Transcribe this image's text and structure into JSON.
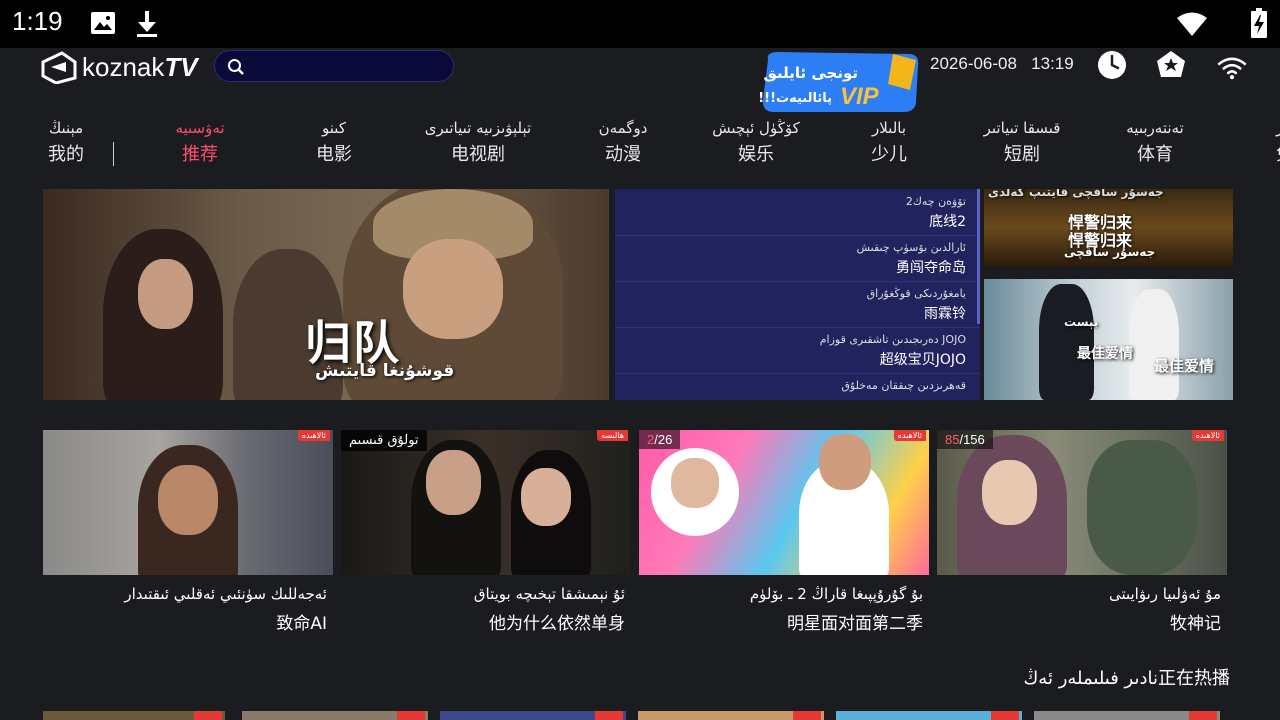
{
  "status_bar": {
    "time": "1:19",
    "icons": [
      "image-icon",
      "download-icon",
      "wifi-icon",
      "battery-icon"
    ]
  },
  "header": {
    "logo_text": "koznak",
    "logo_tv": "TV",
    "search_placeholder": "",
    "vip_banner": {
      "line1": "تونجى ئايلىق",
      "line2": "!!!پائالىيەت",
      "badge": "VIP"
    },
    "date": "2026-06-08",
    "time": "13:19",
    "icons": [
      "clock-icon",
      "home-star-icon",
      "wifi-icon"
    ]
  },
  "nav": {
    "items": [
      {
        "ug": "مېنىڭ",
        "zh": "我的",
        "active": false
      },
      {
        "ug": "تەۋسىيە",
        "zh": "推荐",
        "active": true
      },
      {
        "ug": "كىنو",
        "zh": "电影",
        "active": false
      },
      {
        "ug": "تېلېۋىزىيە تىياتىرى",
        "zh": "电视剧",
        "active": false
      },
      {
        "ug": "دوگمەن",
        "zh": "动漫",
        "active": false
      },
      {
        "ug": "كۆڭۈل ئېچىش",
        "zh": "娱乐",
        "active": false
      },
      {
        "ug": "بالىلار",
        "zh": "少儿",
        "active": false
      },
      {
        "ug": "قىسقا تىياتىر",
        "zh": "短剧",
        "active": false
      },
      {
        "ug": "تەنتەربىيە",
        "zh": "体育",
        "active": false
      },
      {
        "ug": "سز",
        "zh": "免",
        "active": false
      }
    ]
  },
  "hero": {
    "title": "归队",
    "subtitle": "قوشۇنغا قايتىش"
  },
  "hero_list": [
    {
      "ug": "تۆۋەن چەك2",
      "zh": "底线2"
    },
    {
      "ug": "ئارالدىن بۆسۈپ چىقىش",
      "zh": "勇闯夺命岛"
    },
    {
      "ug": "يامغۇردىكى قوڭغۇراق",
      "zh": "雨霖铃"
    },
    {
      "ug": "دەرىجىدىن تاشقىرى قوزام JOJO",
      "zh": "超级宝贝JOJO"
    },
    {
      "ug": "قەھرىزدىن چىققان مەخلۇق",
      "zh": ""
    }
  ],
  "side_posters": [
    {
      "ug": "جەسۇر ساقچى قايتىپ كەلدى",
      "zh": "悍警归来",
      "zh2": "悍警归来",
      "ug2": "جەسۇر ساقچى"
    },
    {
      "zh": "最佳爱情",
      "ug": "بېست",
      "zh2": "最佳爱情"
    }
  ],
  "cards": [
    {
      "tag": "ئالاھىدە",
      "ep_cur": "",
      "ep_total": "",
      "badge": "",
      "title_ug": "ئەجەللىك سۈنئىي ئەقلىي ئىقتىدار",
      "title_zh": "致命AI"
    },
    {
      "tag": "ھالىسە",
      "ep_cur": "",
      "ep_total": "",
      "badge": "تولۇق قىسىم",
      "title_ug": "ئۇ نېمىشقا تېخىچە بويتاق",
      "title_zh": "他为什么依然单身"
    },
    {
      "tag": "ئالاھىدە",
      "ep_cur": "2",
      "ep_total": "/26",
      "badge": "",
      "title_ug": "بۇ گۇرۇپپىغا قاراڭ 2 ـ بۆلۈم",
      "title_zh": "明星面对面第二季"
    },
    {
      "tag": "ئالاھىدە",
      "ep_cur": "85",
      "ep_total": "/156",
      "badge": "",
      "title_ug": "مۇ ئەۋلىيا رىۋايىتى",
      "title_zh": "牧神记"
    }
  ],
  "section": {
    "title_ug": "نادىر فىلىملەر",
    "title_zh": "正在热播",
    "prefix": "ئەڭ"
  },
  "colors": {
    "accent": "#ff4d6d",
    "background": "#1b1c20",
    "list_bg": "#21235e",
    "tag_red": "#e53935"
  }
}
